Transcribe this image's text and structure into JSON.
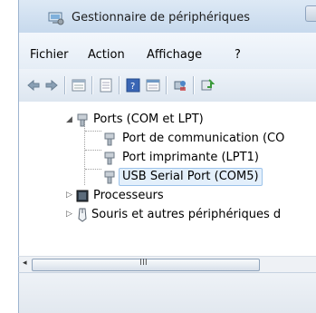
{
  "window": {
    "title": "Gestionnaire de périphériques"
  },
  "menu": {
    "items": [
      {
        "label": "Fichier"
      },
      {
        "label": "Action"
      },
      {
        "label": "Affichage"
      },
      {
        "label": "?"
      }
    ]
  },
  "toolbar": {
    "buttons": [
      "back-icon",
      "forward-icon",
      "properties-icon",
      "details-icon",
      "help-icon",
      "view-icon",
      "scan-hardware-icon",
      "update-driver-icon"
    ]
  },
  "tree": {
    "ports": {
      "label": "Ports (COM et LPT)",
      "expanded": true
    },
    "children": [
      {
        "label": "Port de communication (CO"
      },
      {
        "label": "Port imprimante (LPT1)"
      },
      {
        "label": "USB Serial Port (COM5)",
        "selected": true
      }
    ],
    "processors": {
      "label": "Processeurs",
      "expanded": false
    },
    "mice": {
      "label": "Souris et autres périphériques d",
      "expanded": false
    }
  },
  "scrollbar": {
    "grip": "III"
  }
}
